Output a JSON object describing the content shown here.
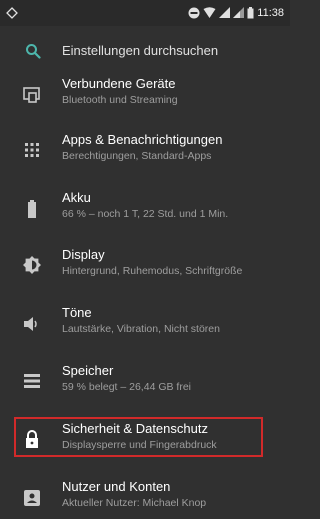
{
  "status_bar": {
    "time": "11:38"
  },
  "search": {
    "placeholder": "Einstellungen durchsuchen"
  },
  "settings": [
    {
      "title": "Verbundene Geräte",
      "subtitle": "Bluetooth und Streaming",
      "icon": "devices-icon"
    },
    {
      "title": "Apps & Benachrichtigungen",
      "subtitle": "Berechtigungen, Standard-Apps",
      "icon": "apps-grid-icon"
    },
    {
      "title": "Akku",
      "subtitle": "66 % – noch 1 T, 22 Std. und 1 Min.",
      "icon": "battery-icon"
    },
    {
      "title": "Display",
      "subtitle": "Hintergrund, Ruhemodus, Schriftgröße",
      "icon": "brightness-icon"
    },
    {
      "title": "Töne",
      "subtitle": "Lautstärke, Vibration, Nicht stören",
      "icon": "volume-icon"
    },
    {
      "title": "Speicher",
      "subtitle": "59 % belegt – 26,44 GB frei",
      "icon": "storage-icon"
    },
    {
      "title": "Sicherheit & Datenschutz",
      "subtitle": "Displaysperre und Fingerabdruck",
      "icon": "lock-icon"
    },
    {
      "title": "Nutzer und Konten",
      "subtitle": "Aktueller Nutzer: Michael Knop",
      "icon": "account-icon"
    }
  ],
  "colors": {
    "background": "#303030",
    "accent": "#4db6ac",
    "highlight": "#d12a2a"
  }
}
